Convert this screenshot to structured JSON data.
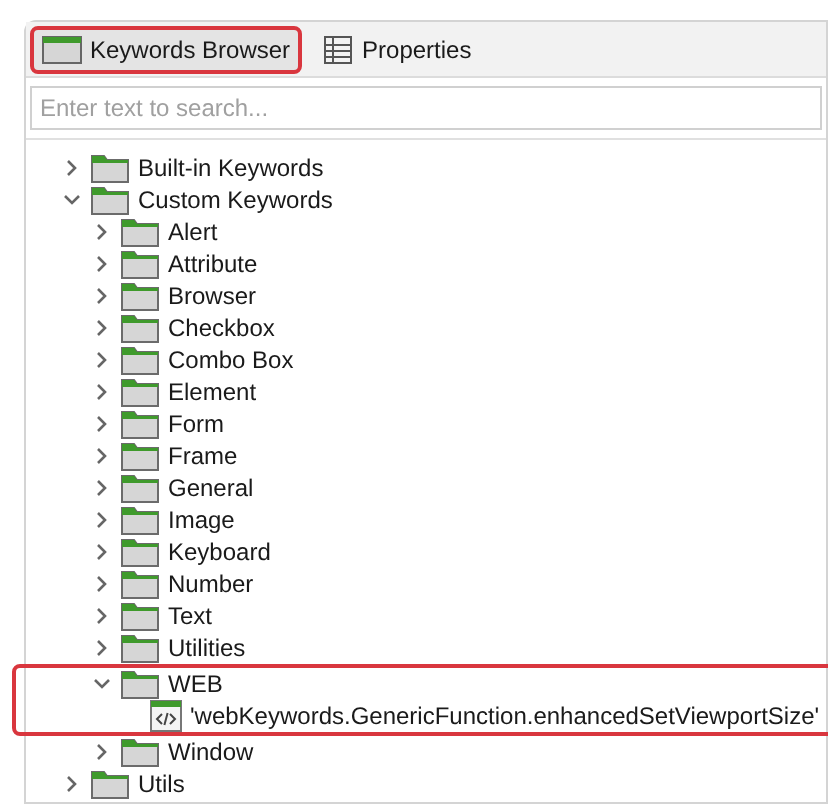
{
  "tabs": [
    {
      "label": "Keywords Browser",
      "selected": true,
      "highlighted": true,
      "kind": "browser"
    },
    {
      "label": "Properties",
      "selected": false,
      "highlighted": false,
      "kind": "table"
    }
  ],
  "search": {
    "placeholder": "Enter text to search..."
  },
  "tree": [
    {
      "label": "Built-in Keywords",
      "kind": "folder",
      "expanded": false
    },
    {
      "label": "Custom Keywords",
      "kind": "folder",
      "expanded": true,
      "children": [
        {
          "label": "Alert",
          "kind": "folder",
          "expanded": false
        },
        {
          "label": "Attribute",
          "kind": "folder",
          "expanded": false
        },
        {
          "label": "Browser",
          "kind": "folder",
          "expanded": false
        },
        {
          "label": "Checkbox",
          "kind": "folder",
          "expanded": false
        },
        {
          "label": "Combo Box",
          "kind": "folder",
          "expanded": false
        },
        {
          "label": "Element",
          "kind": "folder",
          "expanded": false
        },
        {
          "label": "Form",
          "kind": "folder",
          "expanded": false
        },
        {
          "label": "Frame",
          "kind": "folder",
          "expanded": false
        },
        {
          "label": "General",
          "kind": "folder",
          "expanded": false
        },
        {
          "label": "Image",
          "kind": "folder",
          "expanded": false
        },
        {
          "label": "Keyboard",
          "kind": "folder",
          "expanded": false
        },
        {
          "label": "Number",
          "kind": "folder",
          "expanded": false
        },
        {
          "label": "Text",
          "kind": "folder",
          "expanded": false
        },
        {
          "label": "Utilities",
          "kind": "folder",
          "expanded": false
        },
        {
          "label": "WEB",
          "kind": "folder",
          "expanded": true,
          "highlighted": true,
          "children": [
            {
              "label": "'webKeywords.GenericFunction.enhancedSetViewportSize'",
              "kind": "keyword"
            }
          ]
        },
        {
          "label": "Window",
          "kind": "folder",
          "expanded": false
        }
      ]
    },
    {
      "label": "Utils",
      "kind": "folder",
      "expanded": false
    }
  ]
}
